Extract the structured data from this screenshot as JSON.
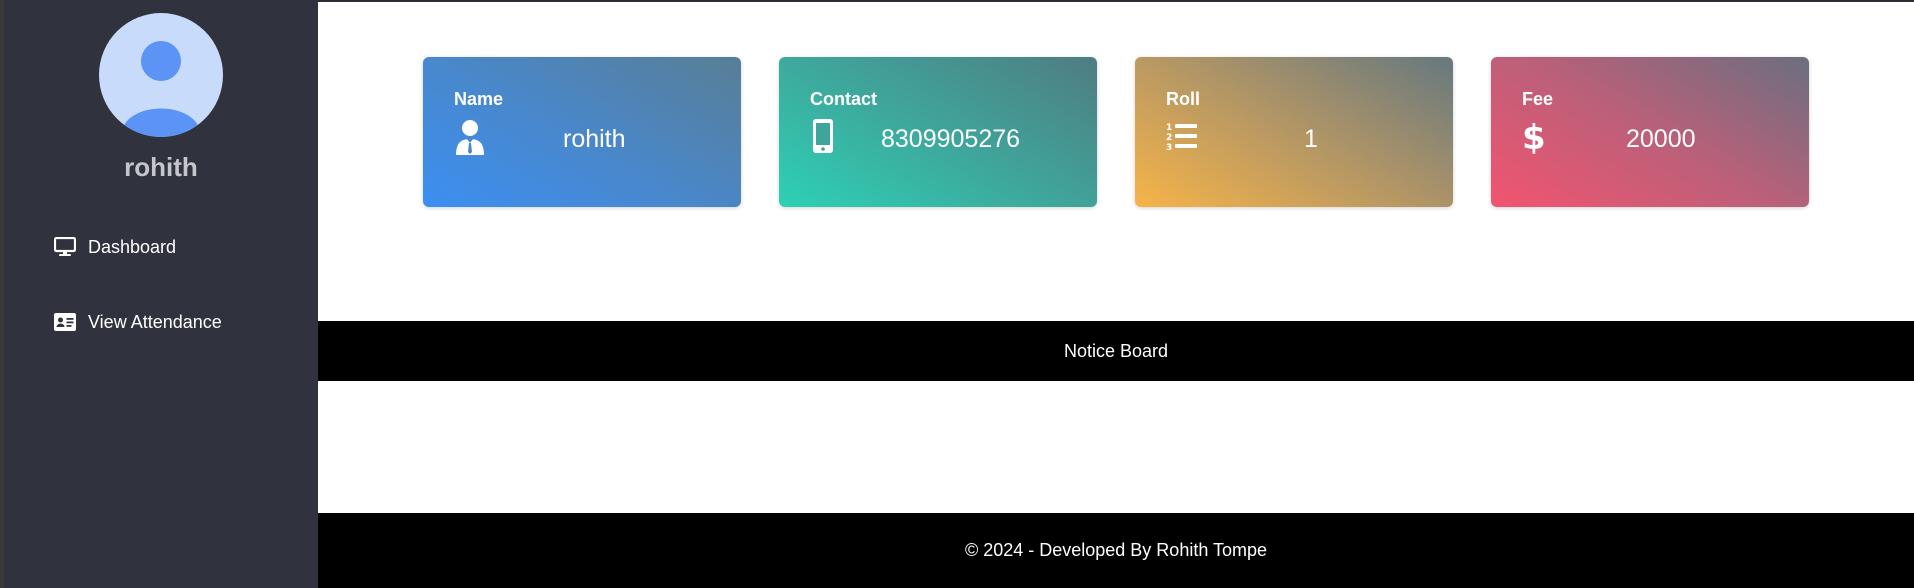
{
  "sidebar": {
    "username": "rohith",
    "items": [
      {
        "label": "Dashboard",
        "icon": "monitor-icon"
      },
      {
        "label": "View Attendance",
        "icon": "id-card-icon"
      }
    ]
  },
  "cards": [
    {
      "label": "Name",
      "value": "rohith",
      "icon": "user-tie-icon",
      "colors": [
        "#3b8ff2",
        "#587e95"
      ]
    },
    {
      "label": "Contact",
      "value": "8309905276",
      "icon": "mobile-phone-icon",
      "colors": [
        "#2dd1b4",
        "#4f7c82"
      ]
    },
    {
      "label": "Roll",
      "value": "1",
      "icon": "ordered-list-icon",
      "colors": [
        "#f7b448",
        "#66787f"
      ]
    },
    {
      "label": "Fee",
      "value": "20000",
      "icon": "dollar-icon",
      "colors": [
        "#f25470",
        "#6a6f80"
      ]
    }
  ],
  "notice_board": {
    "title": "Notice Board"
  },
  "footer": {
    "text": "© 2024 - Developed By Rohith Tompe"
  },
  "colors": {
    "sidebar_bg": "#30333d",
    "bar_bg": "#000000",
    "avatar_bg": "#c8dbfb",
    "avatar_fg": "#5b94f5"
  }
}
